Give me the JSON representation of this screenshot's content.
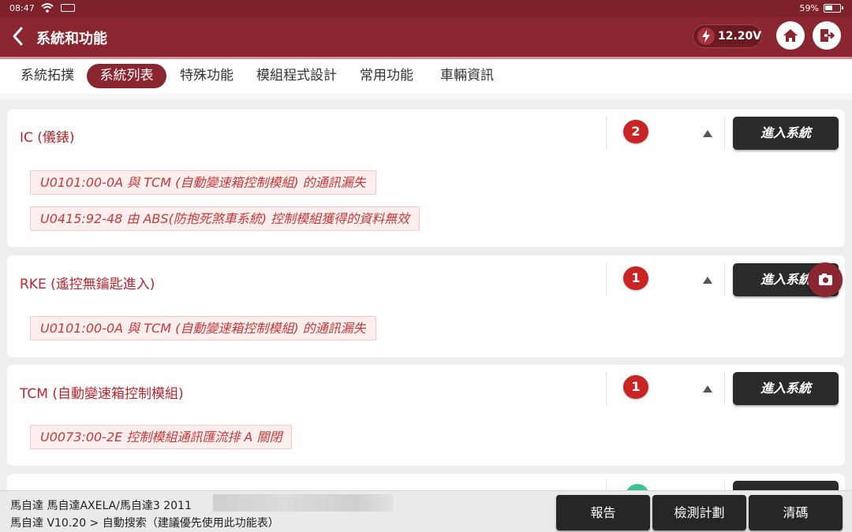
{
  "status_bar": {
    "time": "08:47",
    "battery": "59%"
  },
  "header": {
    "title": "系統和功能",
    "voltage": "12.20V"
  },
  "tabs": [
    {
      "label": "系統拓撲",
      "active": false
    },
    {
      "label": "系統列表",
      "active": true
    },
    {
      "label": "特殊功能",
      "active": false
    },
    {
      "label": "模組程式設計",
      "active": false
    },
    {
      "label": "常用功能",
      "active": false
    },
    {
      "label": "車輛資訊",
      "active": false
    }
  ],
  "systems": [
    {
      "name": "IC (儀錶)",
      "fault_count": "2",
      "enter_label": "進入系統",
      "dtcs": [
        "U0101:00-0A 與 TCM (自動變速箱控制模組) 的通訊漏失",
        "U0415:92-48 由 ABS(防抱死煞車系統) 控制模組獲得的資料無效"
      ]
    },
    {
      "name": "RKE (遙控無鑰匙進入)",
      "fault_count": "1",
      "enter_label": "進入系統",
      "dtcs": [
        "U0101:00-0A 與 TCM (自動變速箱控制模組) 的通訊漏失"
      ]
    },
    {
      "name": "TCM (自動變速箱控制模組)",
      "fault_count": "1",
      "enter_label": "進入系統",
      "dtcs": [
        "U0073:00-2E 控制模組通訊匯流排 A 關閉"
      ]
    }
  ],
  "footer": {
    "vehicle_line": "馬自達   馬自達AXELA/馬自達3   2011",
    "path_prefix": "馬自達 V10.20 > ",
    "path_current": "自動搜索（建議優先使用此功能表）",
    "buttons": {
      "report": "報告",
      "plan": "檢測計劃",
      "clear": "清碼"
    }
  },
  "colors": {
    "brand": "#8a2630",
    "fault_red": "#c82424",
    "dtc_text": "#c33a3a"
  }
}
